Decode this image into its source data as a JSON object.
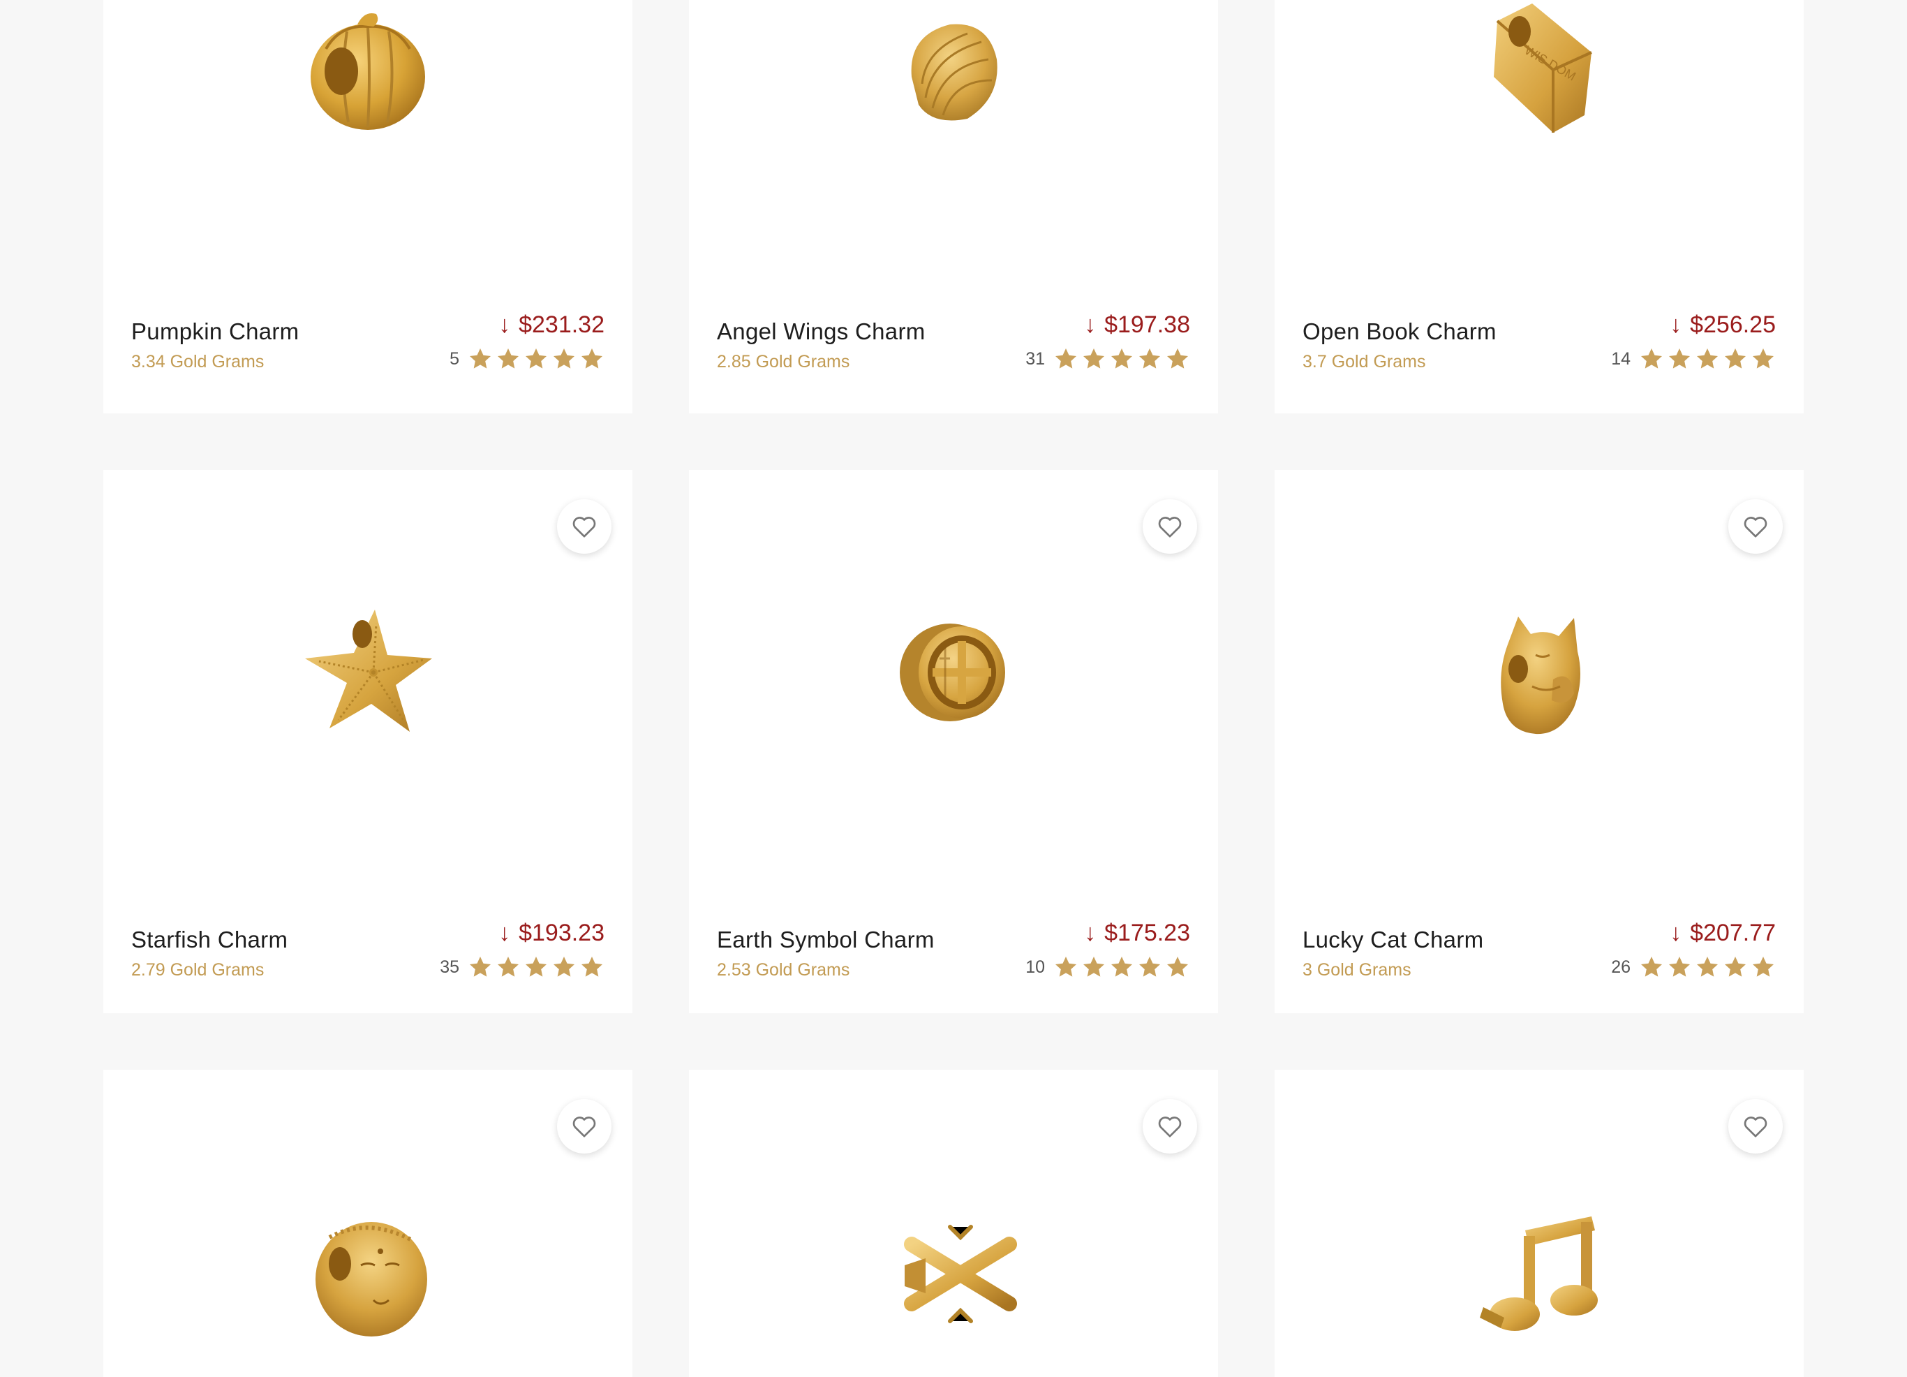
{
  "colors": {
    "page_background": "#f7f7f7",
    "card_background": "#ffffff",
    "price_red": "#9a1c1c",
    "gold_accent": "#c29b53",
    "star_gold": "#c9a15b"
  },
  "icons": {
    "favorite": "heart-outline-icon",
    "rating": "star-icon",
    "price_drop": "down-arrow-icon"
  },
  "products": [
    {
      "name": "Pumpkin Charm",
      "grams": "3.34 Gold Grams",
      "price": "$231.32",
      "price_arrow": "↓",
      "reviews": "5",
      "stars": 5,
      "shape": "pumpkin"
    },
    {
      "name": "Angel Wings Charm",
      "grams": "2.85 Gold Grams",
      "price": "$197.38",
      "price_arrow": "↓",
      "reviews": "31",
      "stars": 5,
      "shape": "wings"
    },
    {
      "name": "Open Book Charm",
      "grams": "3.7 Gold Grams",
      "price": "$256.25",
      "price_arrow": "↓",
      "reviews": "14",
      "stars": 5,
      "shape": "book",
      "engraving": "WIS DOM"
    },
    {
      "name": "Starfish Charm",
      "grams": "2.79 Gold Grams",
      "price": "$193.23",
      "price_arrow": "↓",
      "reviews": "35",
      "stars": 5,
      "shape": "starfish"
    },
    {
      "name": "Earth Symbol Charm",
      "grams": "2.53 Gold Grams",
      "price": "$175.23",
      "price_arrow": "↓",
      "reviews": "10",
      "stars": 5,
      "shape": "earth"
    },
    {
      "name": "Lucky Cat Charm",
      "grams": "3 Gold Grams",
      "price": "$207.77",
      "price_arrow": "↓",
      "reviews": "26",
      "stars": 5,
      "shape": "cat"
    },
    {
      "shape": "buddha"
    },
    {
      "shape": "snowflake"
    },
    {
      "shape": "music-note"
    }
  ]
}
